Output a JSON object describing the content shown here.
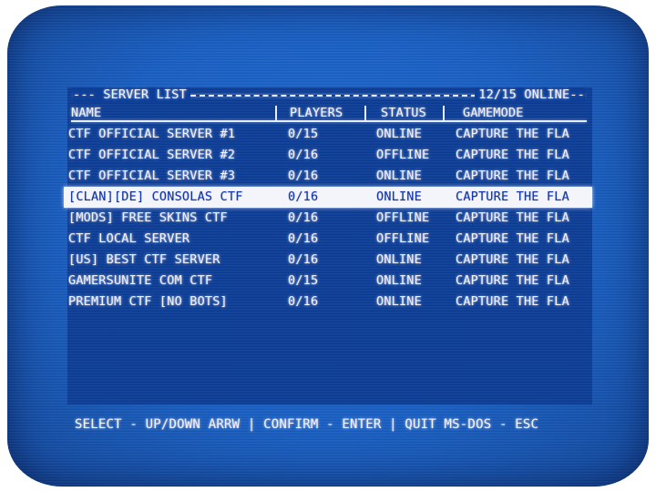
{
  "screen": {
    "title": "SERVER LIST",
    "online_count": "12/15 ONLINE"
  },
  "columns": {
    "name": "NAME",
    "players": "PLAYERS",
    "status": "STATUS",
    "gamemode": "GAMEMODE"
  },
  "servers": [
    {
      "name": "CTF OFFICIAL SERVER #1",
      "players": "0/15",
      "status": "ONLINE",
      "gamemode": "CAPTURE THE FLA"
    },
    {
      "name": "CTF OFFICIAL SERVER #2",
      "players": "0/16",
      "status": "OFFLINE",
      "gamemode": "CAPTURE THE FLA"
    },
    {
      "name": "CTF OFFICIAL SERVER #3",
      "players": "0/16",
      "status": "ONLINE",
      "gamemode": "CAPTURE THE FLA"
    },
    {
      "name": "[CLAN][DE] CONSOLAS CTF",
      "players": "0/16",
      "status": "ONLINE",
      "gamemode": "CAPTURE THE FLA",
      "selected": true
    },
    {
      "name": "[MODS] FREE SKINS CTF",
      "players": "0/16",
      "status": "OFFLINE",
      "gamemode": "CAPTURE THE FLA"
    },
    {
      "name": "CTF LOCAL SERVER",
      "players": "0/16",
      "status": "OFFLINE",
      "gamemode": "CAPTURE THE FLA"
    },
    {
      "name": "[US] BEST CTF SERVER",
      "players": "0/16",
      "status": "ONLINE",
      "gamemode": "CAPTURE THE FLA"
    },
    {
      "name": "GAMERSUNITE COM CTF",
      "players": "0/15",
      "status": "ONLINE",
      "gamemode": "CAPTURE THE FLA"
    },
    {
      "name": "PREMIUM CTF [NO BOTS]",
      "players": "0/16",
      "status": "ONLINE",
      "gamemode": "CAPTURE THE FLA"
    }
  ],
  "footer": {
    "hint": "SELECT - UP/DOWN ARRW | CONFIRM - ENTER | QUIT MS-DOS - ESC"
  },
  "colors": {
    "screen_blue": "#1a60c4",
    "panel_blue": "#0d3f99",
    "text": "#f2f4ff",
    "highlight_bg": "#f3f5fb",
    "highlight_text": "#1436a8"
  }
}
